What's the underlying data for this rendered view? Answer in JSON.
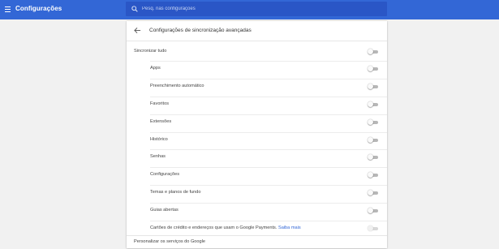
{
  "topbar": {
    "title": "Configurações",
    "menu_icon": "hamburger-menu-icon"
  },
  "search": {
    "icon": "search-icon",
    "placeholder": "Pesq. nas configurações"
  },
  "header": {
    "back_icon": "back-arrow-icon",
    "title": "Configurações de sincronização avançadas"
  },
  "sync_all": {
    "label": "Sincronizar tudo",
    "enabled": false
  },
  "items": [
    {
      "label": "Apps",
      "enabled": false
    },
    {
      "label": "Preenchimento automático",
      "enabled": false
    },
    {
      "label": "Favoritos",
      "enabled": false
    },
    {
      "label": "Extensões",
      "enabled": false
    },
    {
      "label": "Histórico",
      "enabled": false
    },
    {
      "label": "Senhas",
      "enabled": false
    },
    {
      "label": "Configurações",
      "enabled": false
    },
    {
      "label": "Temas e planos de fundo",
      "enabled": false
    },
    {
      "label": "Guias abertas",
      "enabled": false
    }
  ],
  "payments": {
    "label": "Cartões de crédito e endereços que usam o Google Payments.",
    "link": "Saiba mais",
    "enabled": false,
    "disabled": true
  },
  "footer": {
    "label": "Personalizar os serviços do Google"
  },
  "colors": {
    "topbar": "#3367d6",
    "search_box": "#2a56c6",
    "link": "#3367d6",
    "background": "#f1f1f1"
  }
}
